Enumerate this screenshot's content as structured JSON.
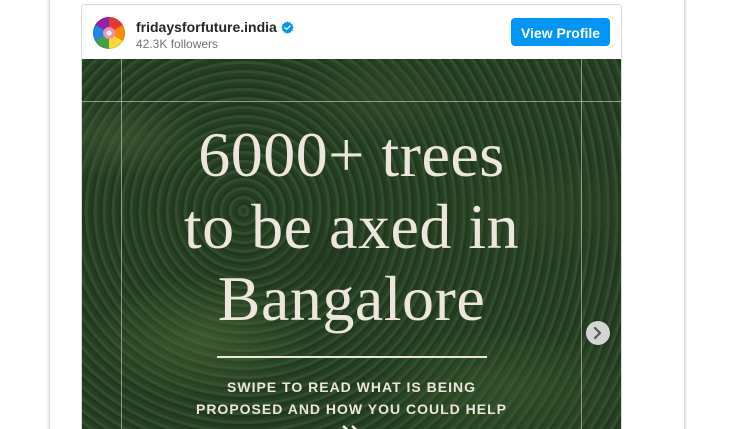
{
  "account": {
    "username": "fridaysforfuture.india",
    "verified_icon": "verified-badge-icon",
    "followers": "42.3K followers",
    "avatar_icon": "rainbow-flag-avatar"
  },
  "actions": {
    "view_profile_label": "View Profile"
  },
  "post": {
    "headline_lines": [
      "6000+ trees",
      "to be axed in",
      "Bangalore"
    ],
    "subtext_lines": [
      "SWIPE TO READ WHAT IS BEING",
      "PROPOSED AND HOW YOU COULD HELP"
    ],
    "next_icon": "chevron-right-icon",
    "swipe_icon": "double-chevron-right-icon"
  },
  "colors": {
    "button": "#0095f6",
    "verified": "#0095f6",
    "text_primary": "#262626",
    "text_secondary": "#737373",
    "overlay_text": "#ece6dc"
  }
}
